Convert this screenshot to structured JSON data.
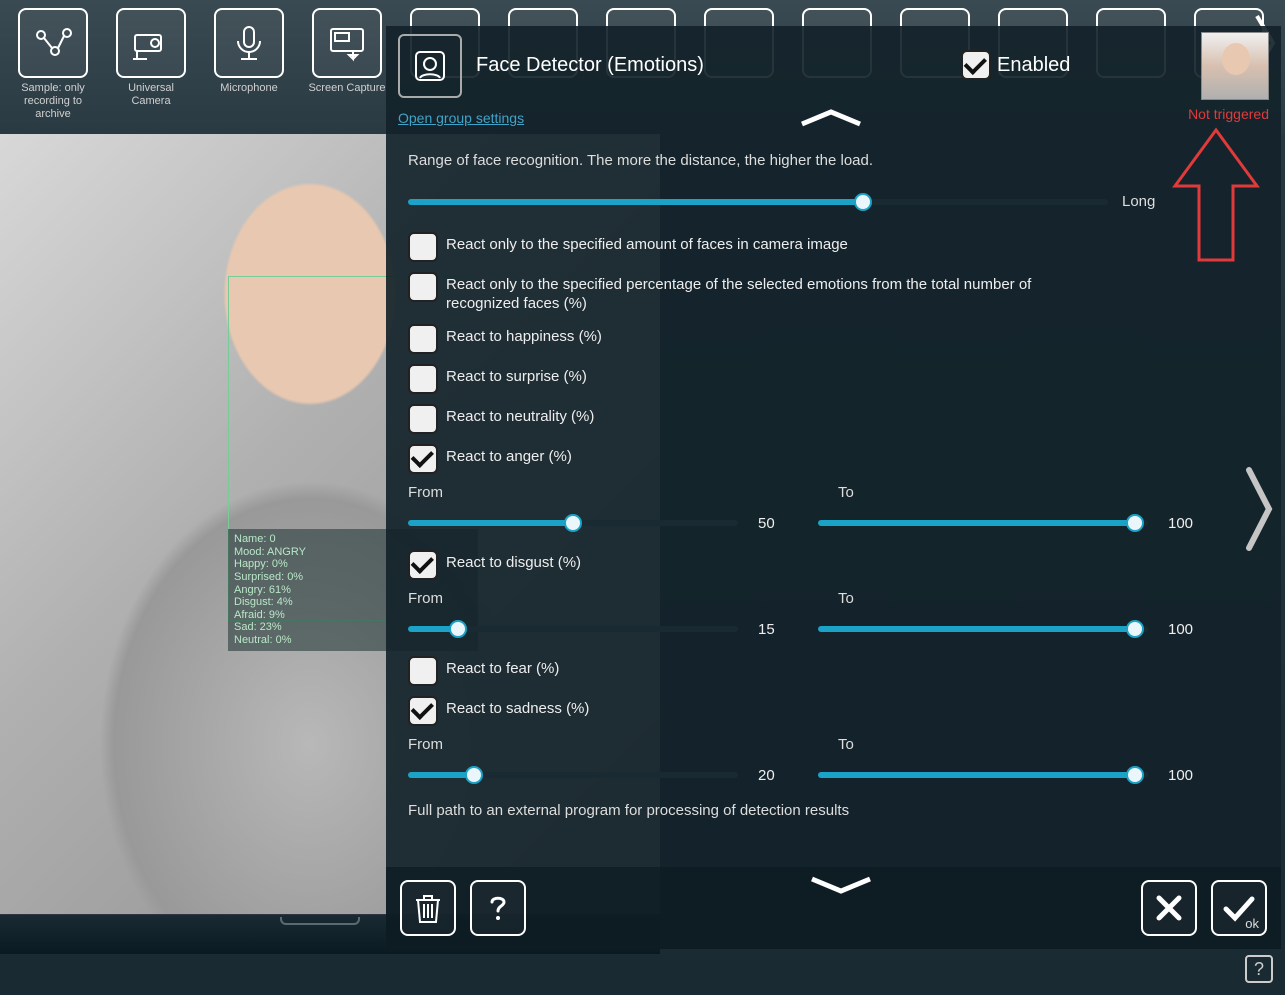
{
  "toolbar": {
    "items": [
      {
        "name": "sample-archive",
        "label": "Sample: only recording to archive"
      },
      {
        "name": "universal-camera",
        "label": "Universal Camera"
      },
      {
        "name": "microphone",
        "label": "Microphone"
      },
      {
        "name": "screen-capture",
        "label": "Screen Capture"
      }
    ]
  },
  "modal": {
    "title": "Face Detector (Emotions)",
    "enabled_label": "Enabled",
    "enabled_checked": true,
    "open_group": "Open group settings",
    "status": "Not triggered",
    "range_desc": "Range of face recognition. The more the distance, the higher the load.",
    "range_end_label": "Long",
    "range_value_pct": 65,
    "checks": {
      "amount_faces": {
        "label": "React only to the specified amount of faces in camera image",
        "checked": false
      },
      "pct_emotions": {
        "label": "React only to the specified percentage of the selected emotions from the total number of recognized faces (%)",
        "checked": false
      },
      "happiness": {
        "label": "React to happiness (%)",
        "checked": false
      },
      "surprise": {
        "label": "React to surprise (%)",
        "checked": false
      },
      "neutrality": {
        "label": "React to neutrality (%)",
        "checked": false
      },
      "anger": {
        "label": "React to anger (%)",
        "checked": true
      },
      "disgust": {
        "label": "React to disgust (%)",
        "checked": true
      },
      "fear": {
        "label": "React to fear (%)",
        "checked": false
      },
      "sadness": {
        "label": "React to sadness (%)",
        "checked": true
      }
    },
    "ranges": {
      "from_label": "From",
      "to_label": "To",
      "anger": {
        "from": 50,
        "to": 100
      },
      "disgust": {
        "from": 15,
        "to": 100
      },
      "sadness": {
        "from": 20,
        "to": 100
      }
    },
    "ext_program_label": "Full path to an external program for processing of detection results",
    "ok_label": "ok"
  },
  "face_overlay": {
    "lines": [
      "Name: 0",
      "Mood: ANGRY",
      "Happy: 0%",
      "Surprised: 0%",
      "Angry: 61%",
      "Disgust: 4%",
      "Afraid: 9%",
      "Sad: 23%",
      "Neutral: 0%"
    ]
  }
}
